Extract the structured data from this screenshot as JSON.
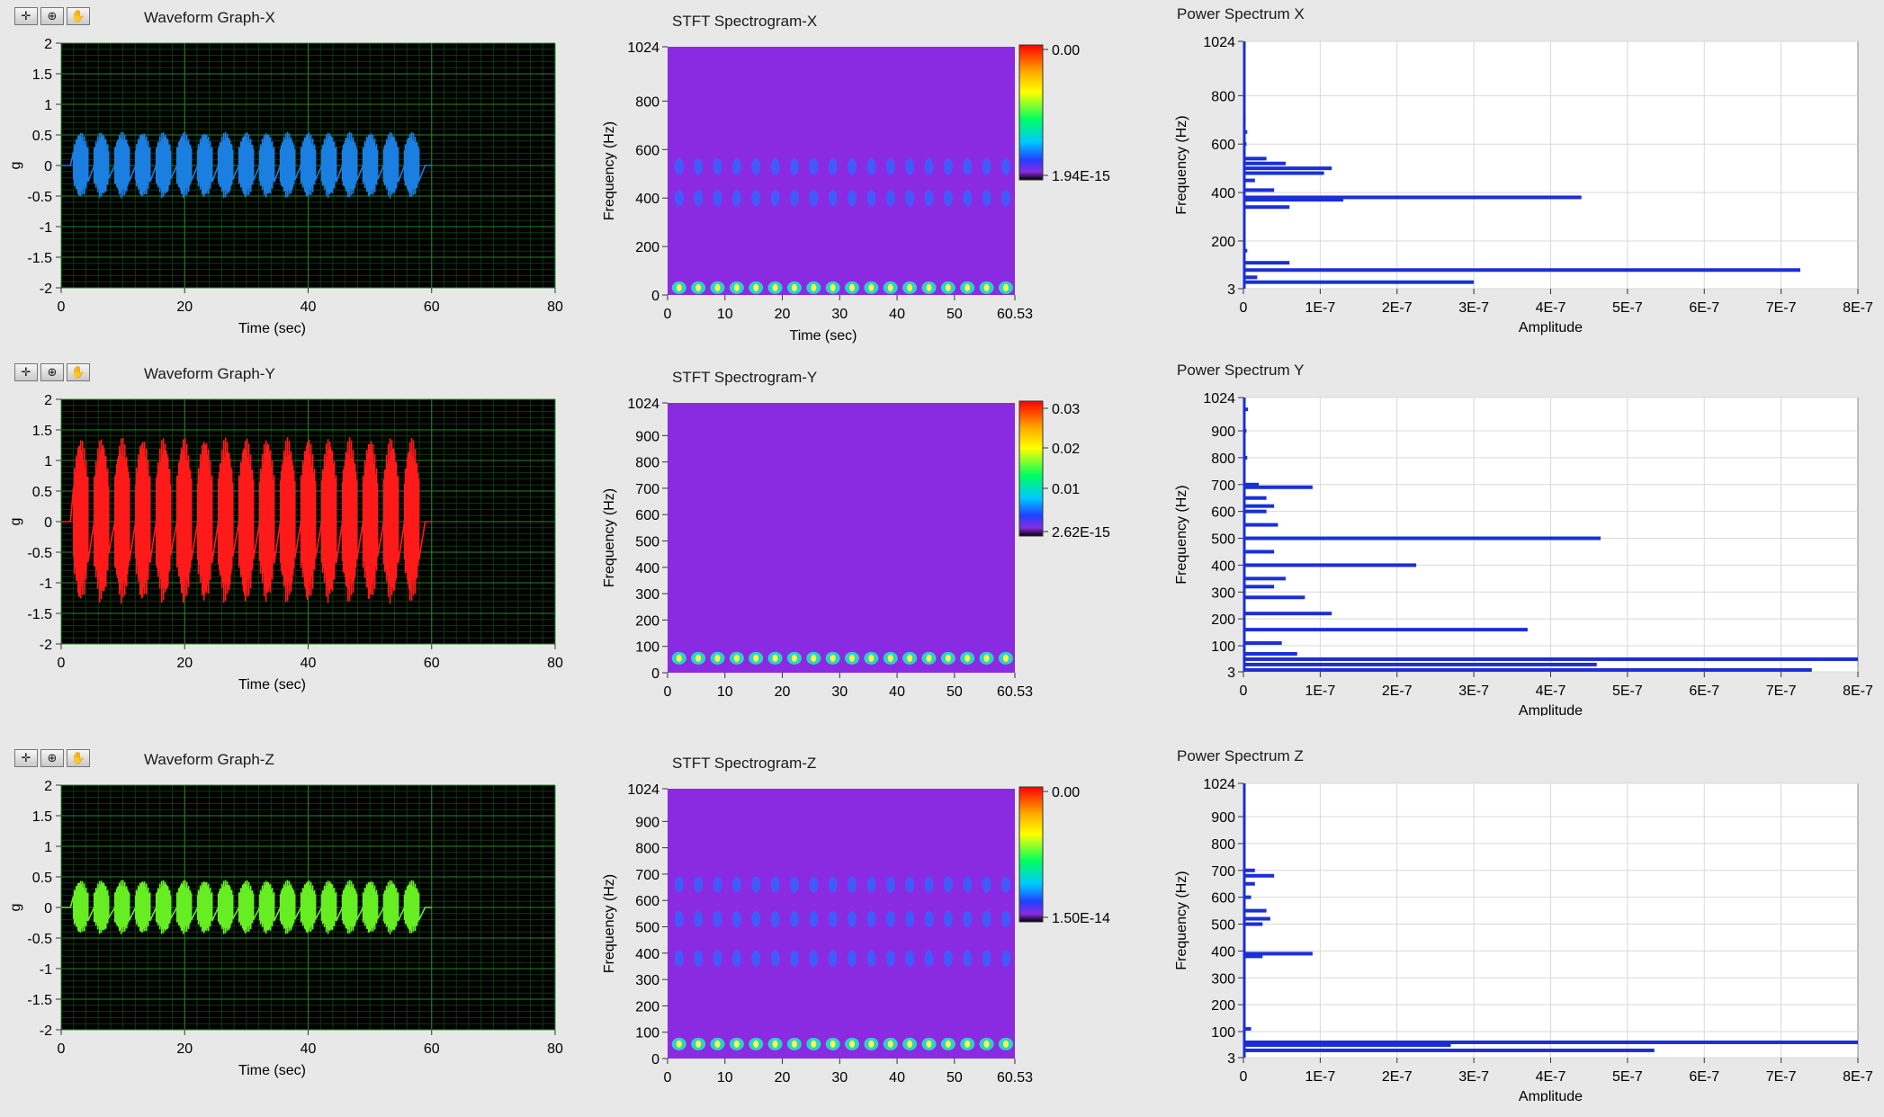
{
  "rows": [
    {
      "waveform": {
        "title": "Waveform Graph-X",
        "color": "#1a7fe0",
        "amplitude_g": 0.55,
        "ylim": [
          -2,
          2
        ],
        "yticks": [
          "2",
          "1.5",
          "1",
          "0.5",
          "0",
          "-0.5",
          "-1",
          "-1.5",
          "-2"
        ],
        "xlim": [
          0,
          80
        ],
        "xticks": [
          "0",
          "20",
          "40",
          "60",
          "80"
        ],
        "xlabel": "Time (sec)",
        "ylabel": "g"
      },
      "spectrogram": {
        "title": "STFT Spectrogram-X",
        "ylabel": "Frequency (Hz)",
        "xlabel": "Time (sec)",
        "yticks": [
          "1024",
          "800",
          "600",
          "400",
          "200",
          "0"
        ],
        "xticks": [
          "0",
          "10",
          "20",
          "30",
          "40",
          "50",
          "60.53"
        ],
        "colorbar": [
          "0.00",
          "1.94E-15"
        ],
        "bands_hz": [
          30,
          400,
          530
        ]
      },
      "power": {
        "title": "Power Spectrum X",
        "xlabel": "Amplitude",
        "ylabel": "Frequency (Hz)",
        "yticks": [
          "1024",
          "800",
          "600",
          "400",
          "200",
          "3"
        ],
        "xticks": [
          "0",
          "1E-7",
          "2E-7",
          "3E-7",
          "4E-7",
          "5E-7",
          "6E-7",
          "7E-7",
          "8E-7"
        ],
        "bars": [
          [
            30,
            3.0
          ],
          [
            50,
            0.18
          ],
          [
            80,
            7.25
          ],
          [
            110,
            0.6
          ],
          [
            160,
            0.05
          ],
          [
            340,
            0.6
          ],
          [
            370,
            1.3
          ],
          [
            380,
            4.4
          ],
          [
            410,
            0.4
          ],
          [
            450,
            0.15
          ],
          [
            480,
            1.05
          ],
          [
            500,
            1.15
          ],
          [
            520,
            0.55
          ],
          [
            540,
            0.3
          ],
          [
            600,
            0.04
          ],
          [
            650,
            0.05
          ],
          [
            700,
            0.03
          ]
        ],
        "xlim": [
          0,
          8e-07
        ]
      }
    },
    {
      "waveform": {
        "title": "Waveform Graph-Y",
        "color": "#ff1a1a",
        "amplitude_g": 1.38,
        "ylim": [
          -2,
          2
        ],
        "yticks": [
          "2",
          "1.5",
          "1",
          "0.5",
          "0",
          "-0.5",
          "-1",
          "-1.5",
          "-2"
        ],
        "xlim": [
          0,
          80
        ],
        "xticks": [
          "0",
          "20",
          "40",
          "60",
          "80"
        ],
        "xlabel": "Time (sec)",
        "ylabel": "g"
      },
      "spectrogram": {
        "title": "STFT Spectrogram-Y",
        "ylabel": "Frequency (Hz)",
        "xlabel": "Time (sec)",
        "yticks": [
          "1024",
          "900",
          "800",
          "700",
          "600",
          "500",
          "400",
          "300",
          "200",
          "100",
          "0"
        ],
        "xticks": [
          "0",
          "10",
          "20",
          "30",
          "40",
          "50",
          "60.53"
        ],
        "colorbar": [
          "0.03",
          "0.02",
          "0.01",
          "2.62E-15"
        ],
        "bands_hz": [
          55
        ]
      },
      "power": {
        "title": "Power Spectrum Y",
        "xlabel": "Amplitude",
        "ylabel": "Frequency (Hz)",
        "yticks": [
          "1024",
          "900",
          "800",
          "700",
          "600",
          "500",
          "400",
          "300",
          "200",
          "100",
          "3"
        ],
        "xticks": [
          "0",
          "1E-7",
          "2E-7",
          "3E-7",
          "4E-7",
          "5E-7",
          "6E-7",
          "7E-7",
          "8E-7"
        ],
        "bars": [
          [
            10,
            7.4
          ],
          [
            30,
            4.6
          ],
          [
            50,
            8.0
          ],
          [
            70,
            0.7
          ],
          [
            110,
            0.5
          ],
          [
            160,
            3.7
          ],
          [
            220,
            1.15
          ],
          [
            280,
            0.8
          ],
          [
            320,
            0.4
          ],
          [
            350,
            0.55
          ],
          [
            400,
            2.25
          ],
          [
            450,
            0.4
          ],
          [
            500,
            4.65
          ],
          [
            550,
            0.45
          ],
          [
            600,
            0.3
          ],
          [
            620,
            0.4
          ],
          [
            650,
            0.3
          ],
          [
            690,
            0.9
          ],
          [
            700,
            0.2
          ],
          [
            800,
            0.05
          ],
          [
            900,
            0.04
          ],
          [
            980,
            0.06
          ]
        ],
        "xlim": [
          0,
          8e-07
        ]
      }
    },
    {
      "waveform": {
        "title": "Waveform Graph-Z",
        "color": "#66ee22",
        "amplitude_g": 0.45,
        "ylim": [
          -2,
          2
        ],
        "yticks": [
          "2",
          "1.5",
          "1",
          "0.5",
          "0",
          "-0.5",
          "-1",
          "-1.5",
          "-2"
        ],
        "xlim": [
          0,
          80
        ],
        "xticks": [
          "0",
          "20",
          "40",
          "60",
          "80"
        ],
        "xlabel": "Time (sec)",
        "ylabel": "g"
      },
      "spectrogram": {
        "title": "STFT Spectrogram-Z",
        "ylabel": "Frequency (Hz)",
        "xlabel": "Time (sec)",
        "yticks": [
          "1024",
          "900",
          "800",
          "700",
          "600",
          "500",
          "400",
          "300",
          "200",
          "100",
          "0"
        ],
        "xticks": [
          "0",
          "10",
          "20",
          "30",
          "40",
          "50",
          "60.53"
        ],
        "colorbar": [
          "0.00",
          "1.50E-14"
        ],
        "bands_hz": [
          55,
          380,
          530,
          660
        ]
      },
      "power": {
        "title": "Power Spectrum Z",
        "xlabel": "Amplitude",
        "ylabel": "Frequency (Hz)",
        "yticks": [
          "1024",
          "900",
          "800",
          "700",
          "600",
          "500",
          "400",
          "300",
          "200",
          "100",
          "3"
        ],
        "xticks": [
          "0",
          "1E-7",
          "2E-7",
          "3E-7",
          "4E-7",
          "5E-7",
          "6E-7",
          "7E-7",
          "8E-7"
        ],
        "bars": [
          [
            30,
            5.35
          ],
          [
            50,
            2.7
          ],
          [
            60,
            8.0
          ],
          [
            110,
            0.1
          ],
          [
            380,
            0.25
          ],
          [
            390,
            0.9
          ],
          [
            500,
            0.25
          ],
          [
            520,
            0.35
          ],
          [
            550,
            0.3
          ],
          [
            600,
            0.1
          ],
          [
            650,
            0.15
          ],
          [
            680,
            0.4
          ],
          [
            700,
            0.15
          ]
        ],
        "xlim": [
          0,
          8e-07
        ]
      }
    }
  ]
}
